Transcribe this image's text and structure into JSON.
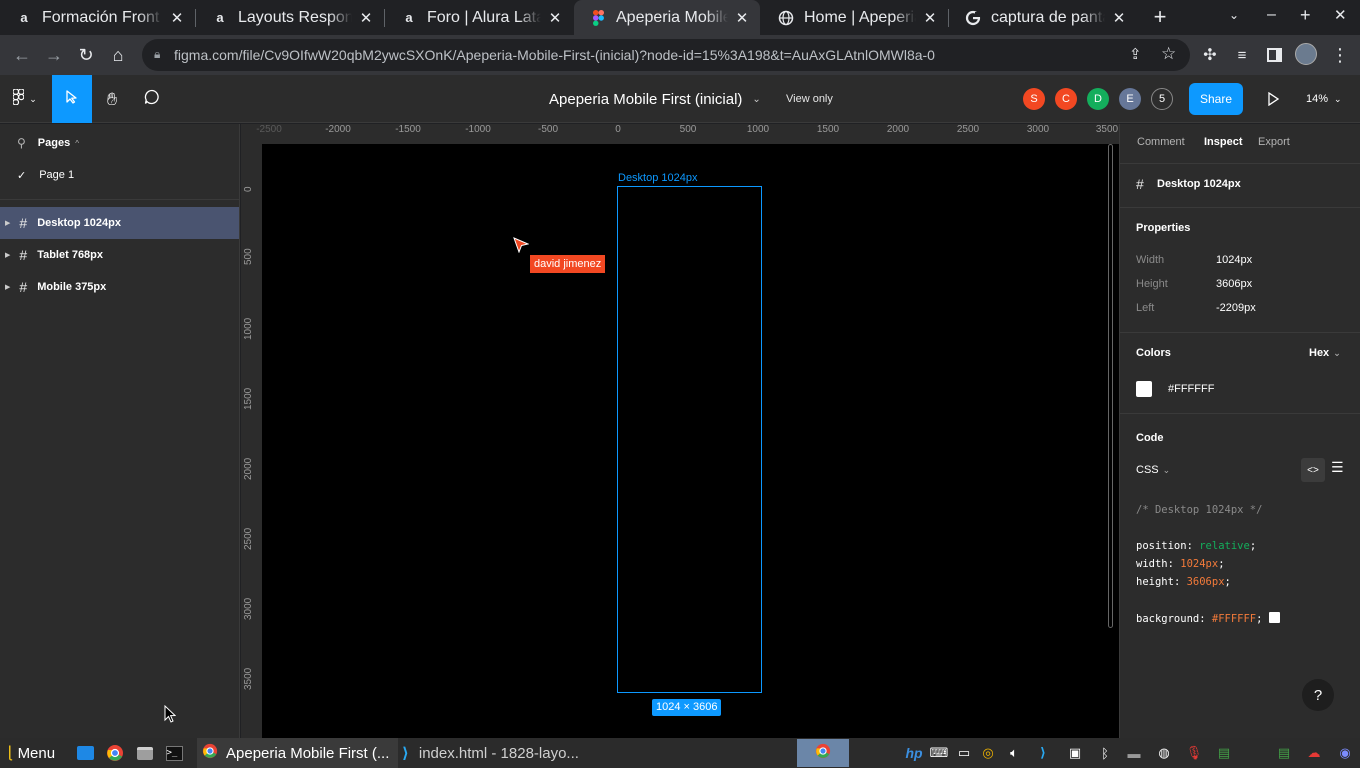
{
  "browser": {
    "tabs": [
      {
        "title": "Formación Front E",
        "favicon": "alura-icon",
        "active": false
      },
      {
        "title": "Layouts Responsi",
        "favicon": "alura-icon",
        "active": false
      },
      {
        "title": "Foro | Alura Latam",
        "favicon": "alura-icon",
        "active": false
      },
      {
        "title": "Apeperia Mobile F",
        "favicon": "figma-icon",
        "active": true
      },
      {
        "title": "Home | Apeperia",
        "favicon": "globe-icon",
        "active": false
      },
      {
        "title": "captura de pantal",
        "favicon": "google-icon",
        "active": false
      }
    ],
    "url": "figma.com/file/Cv9OIfwW20qbM2ywcSXOnK/Apeperia-Mobile-First-(inicial)?node-id=15%3A198&t=AuAxGLAtnlOMWl8a-0"
  },
  "figma": {
    "file_title": "Apeperia Mobile First (inicial)",
    "view_mode": "View only",
    "collaborators": [
      {
        "initial": "S",
        "color": "#f24822"
      },
      {
        "initial": "C",
        "color": "#f24822"
      },
      {
        "initial": "D",
        "color": "#14ae5c"
      },
      {
        "initial": "E",
        "color": "#667799"
      }
    ],
    "extra_count": "5",
    "share_label": "Share",
    "zoom": "14%",
    "accent": "#0d99ff"
  },
  "left_panel": {
    "pages_label": "Pages",
    "current_page": "Page 1",
    "layers": [
      "Desktop 1024px",
      "Tablet 768px",
      "Mobile 375px"
    ]
  },
  "canvas": {
    "h_ruler": [
      "-2500",
      "-2000",
      "-1500",
      "-1000",
      "-500",
      "0",
      "500",
      "1000",
      "1500",
      "2000",
      "2500",
      "3000",
      "3500"
    ],
    "v_ruler": [
      "0",
      "500",
      "1000",
      "1500",
      "2000",
      "2500",
      "3000",
      "3500"
    ],
    "frame_label": "Desktop 1024px",
    "frame_size": "1024 × 3606",
    "cursor_user": "david jimenez"
  },
  "right_panel": {
    "tabs": [
      "Comment",
      "Inspect",
      "Export"
    ],
    "active_tab": "Inspect",
    "selection_name": "Desktop 1024px",
    "properties_title": "Properties",
    "properties": [
      {
        "label": "Width",
        "value": "1024px"
      },
      {
        "label": "Height",
        "value": "3606px"
      },
      {
        "label": "Left",
        "value": "-2209px"
      }
    ],
    "colors_title": "Colors",
    "color_format": "Hex",
    "color_value": "#FFFFFF",
    "code_title": "Code",
    "code_lang": "CSS",
    "code_comment": "/* Desktop 1024px */",
    "code_lines": [
      {
        "prop": "position",
        "val": "relative"
      },
      {
        "prop": "width",
        "val": "1024px"
      },
      {
        "prop": "height",
        "val": "3606px"
      }
    ],
    "code_bg": {
      "prop": "background",
      "val": "#FFFFFF"
    },
    "help": "?"
  },
  "taskbar": {
    "menu_label": "Menu",
    "windows": [
      "Apeperia Mobile First (...",
      "index.html - 1828-layo..."
    ]
  }
}
